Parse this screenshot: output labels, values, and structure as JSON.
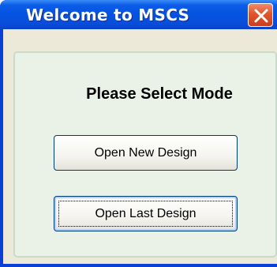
{
  "window": {
    "title": "Welcome to MSCS"
  },
  "dialog": {
    "heading": "Please Select Mode",
    "open_new_label": "Open New Design",
    "open_last_label": "Open Last Design"
  },
  "colors": {
    "titlebar_blue": "#0553e0",
    "close_red": "#e2542b",
    "panel_green": "#eaf2e8",
    "client_bg": "#ece9d8"
  },
  "icons": {
    "close": "close-icon"
  }
}
